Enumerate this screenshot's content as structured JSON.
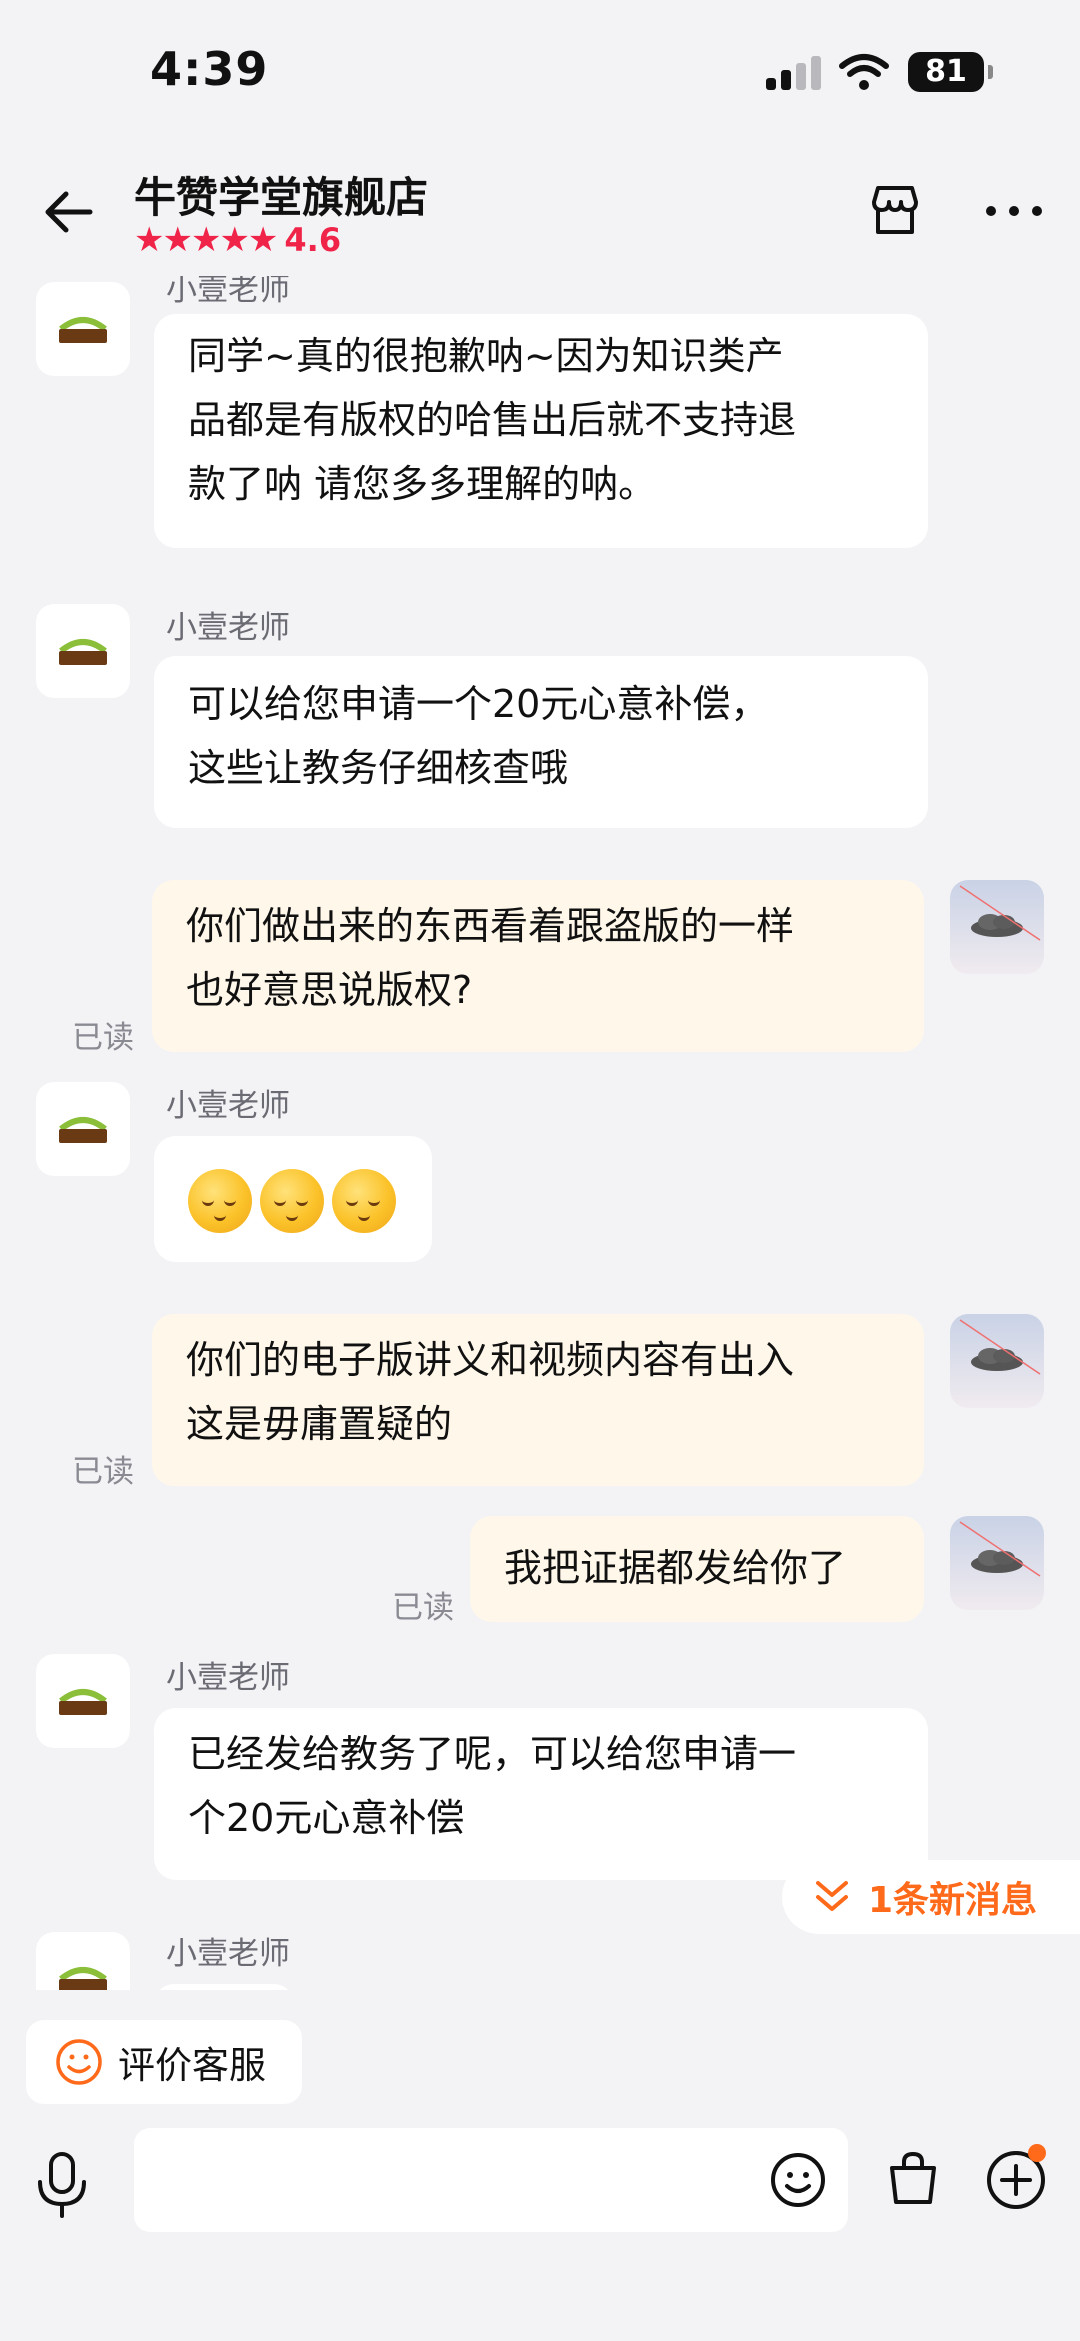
{
  "status_bar": {
    "time": "4:39",
    "battery": "81"
  },
  "header": {
    "shop_name": "牛赞学堂旗舰店",
    "rating": "4.6",
    "stars": "★★★★★"
  },
  "messages": [
    {
      "sender": "小壹老师",
      "lines": [
        "同学~真的很抱歉呐~因为知识类产",
        "品都是有版权的哈售出后就不支持退",
        "款了呐 请您多多理解的呐。"
      ]
    },
    {
      "sender": "小壹老师",
      "lines": [
        "可以给您申请一个20元心意补偿，",
        "这些让教务仔细核查哦"
      ]
    },
    {
      "lines": [
        "你们做出来的东西看着跟盗版的一样",
        "也好意思说版权?"
      ],
      "status": "已读"
    },
    {
      "sender": "小壹老师",
      "emojis": [
        "pensive-face",
        "pensive-face",
        "pensive-face"
      ]
    },
    {
      "lines": [
        "你们的电子版讲义和视频内容有出入",
        "这是毋庸置疑的"
      ],
      "status": "已读"
    },
    {
      "lines": [
        "我把证据都发给你了"
      ],
      "status": "已读"
    },
    {
      "sender": "小壹老师",
      "lines": [
        "已经发给教务了呢，可以给您申请一",
        "个20元心意补偿"
      ]
    },
    {
      "sender": "小壹老师"
    }
  ],
  "new_message_tip": "1条新消息",
  "bottom": {
    "rate_service": "评价客服",
    "input_placeholder": ""
  },
  "colors": {
    "accent_red": "#f02348",
    "accent_orange": "#ff6a1a",
    "out_bubble": "#fff7ea"
  }
}
